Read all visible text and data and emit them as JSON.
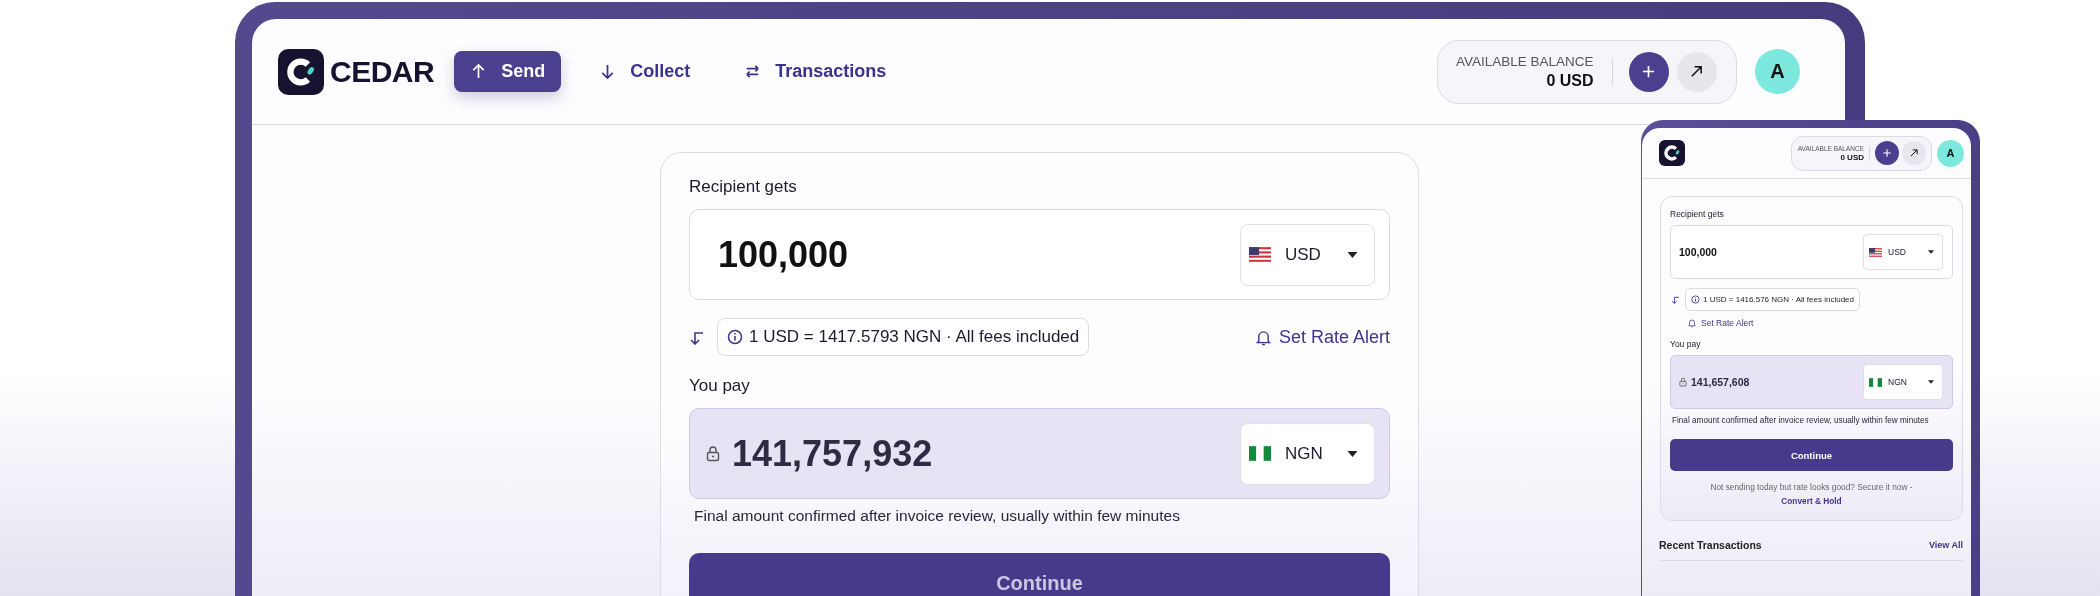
{
  "desktop": {
    "brand": "CEDAR",
    "nav": [
      {
        "label": "Send",
        "kind": "up",
        "selected": true
      },
      {
        "label": "Collect",
        "kind": "down",
        "selected": false
      },
      {
        "label": "Transactions",
        "kind": "swap",
        "selected": false
      }
    ],
    "balance": {
      "label": "AVAILABLE BALANCE",
      "amount": "0 USD"
    },
    "avatar": "A",
    "form": {
      "recipient": {
        "label": "Recipient gets",
        "amount": "100,000",
        "currency": {
          "code": "USD",
          "kind": "us"
        },
        "locked": false
      },
      "rate": "1 USD = 1417.5793 NGN · All fees included",
      "rate_alert": "Set Rate Alert",
      "pay": {
        "label": "You pay",
        "amount": "141,757,932",
        "currency": {
          "code": "NGN",
          "kind": "ng"
        },
        "locked": true
      },
      "note": "Final amount confirmed after invoice review, usually within few minutes",
      "continue": "Continue"
    }
  },
  "mobile": {
    "balance": {
      "label": "AVAILABLE BALANCE",
      "amount": "0 USD"
    },
    "avatar": "A",
    "form": {
      "recipient": {
        "label": "Recipient gets",
        "amount": "100,000",
        "currency": {
          "code": "USD",
          "kind": "us"
        },
        "locked": false
      },
      "rate": "1 USD = 1416.576 NGN · All fees included",
      "rate_alert": "Set Rate Alert",
      "pay": {
        "label": "You pay",
        "amount": "141,657,608",
        "currency": {
          "code": "NGN",
          "kind": "ng"
        },
        "locked": true
      },
      "note": "Final amount confirmed after invoice review, usually within few minutes",
      "continue": "Continue"
    },
    "secure_text": "Not sending today but rate looks good? Secure it now -",
    "secure_link": "Convert & Hold",
    "recent_title": "Recent Transactions",
    "view_all": "View All"
  }
}
